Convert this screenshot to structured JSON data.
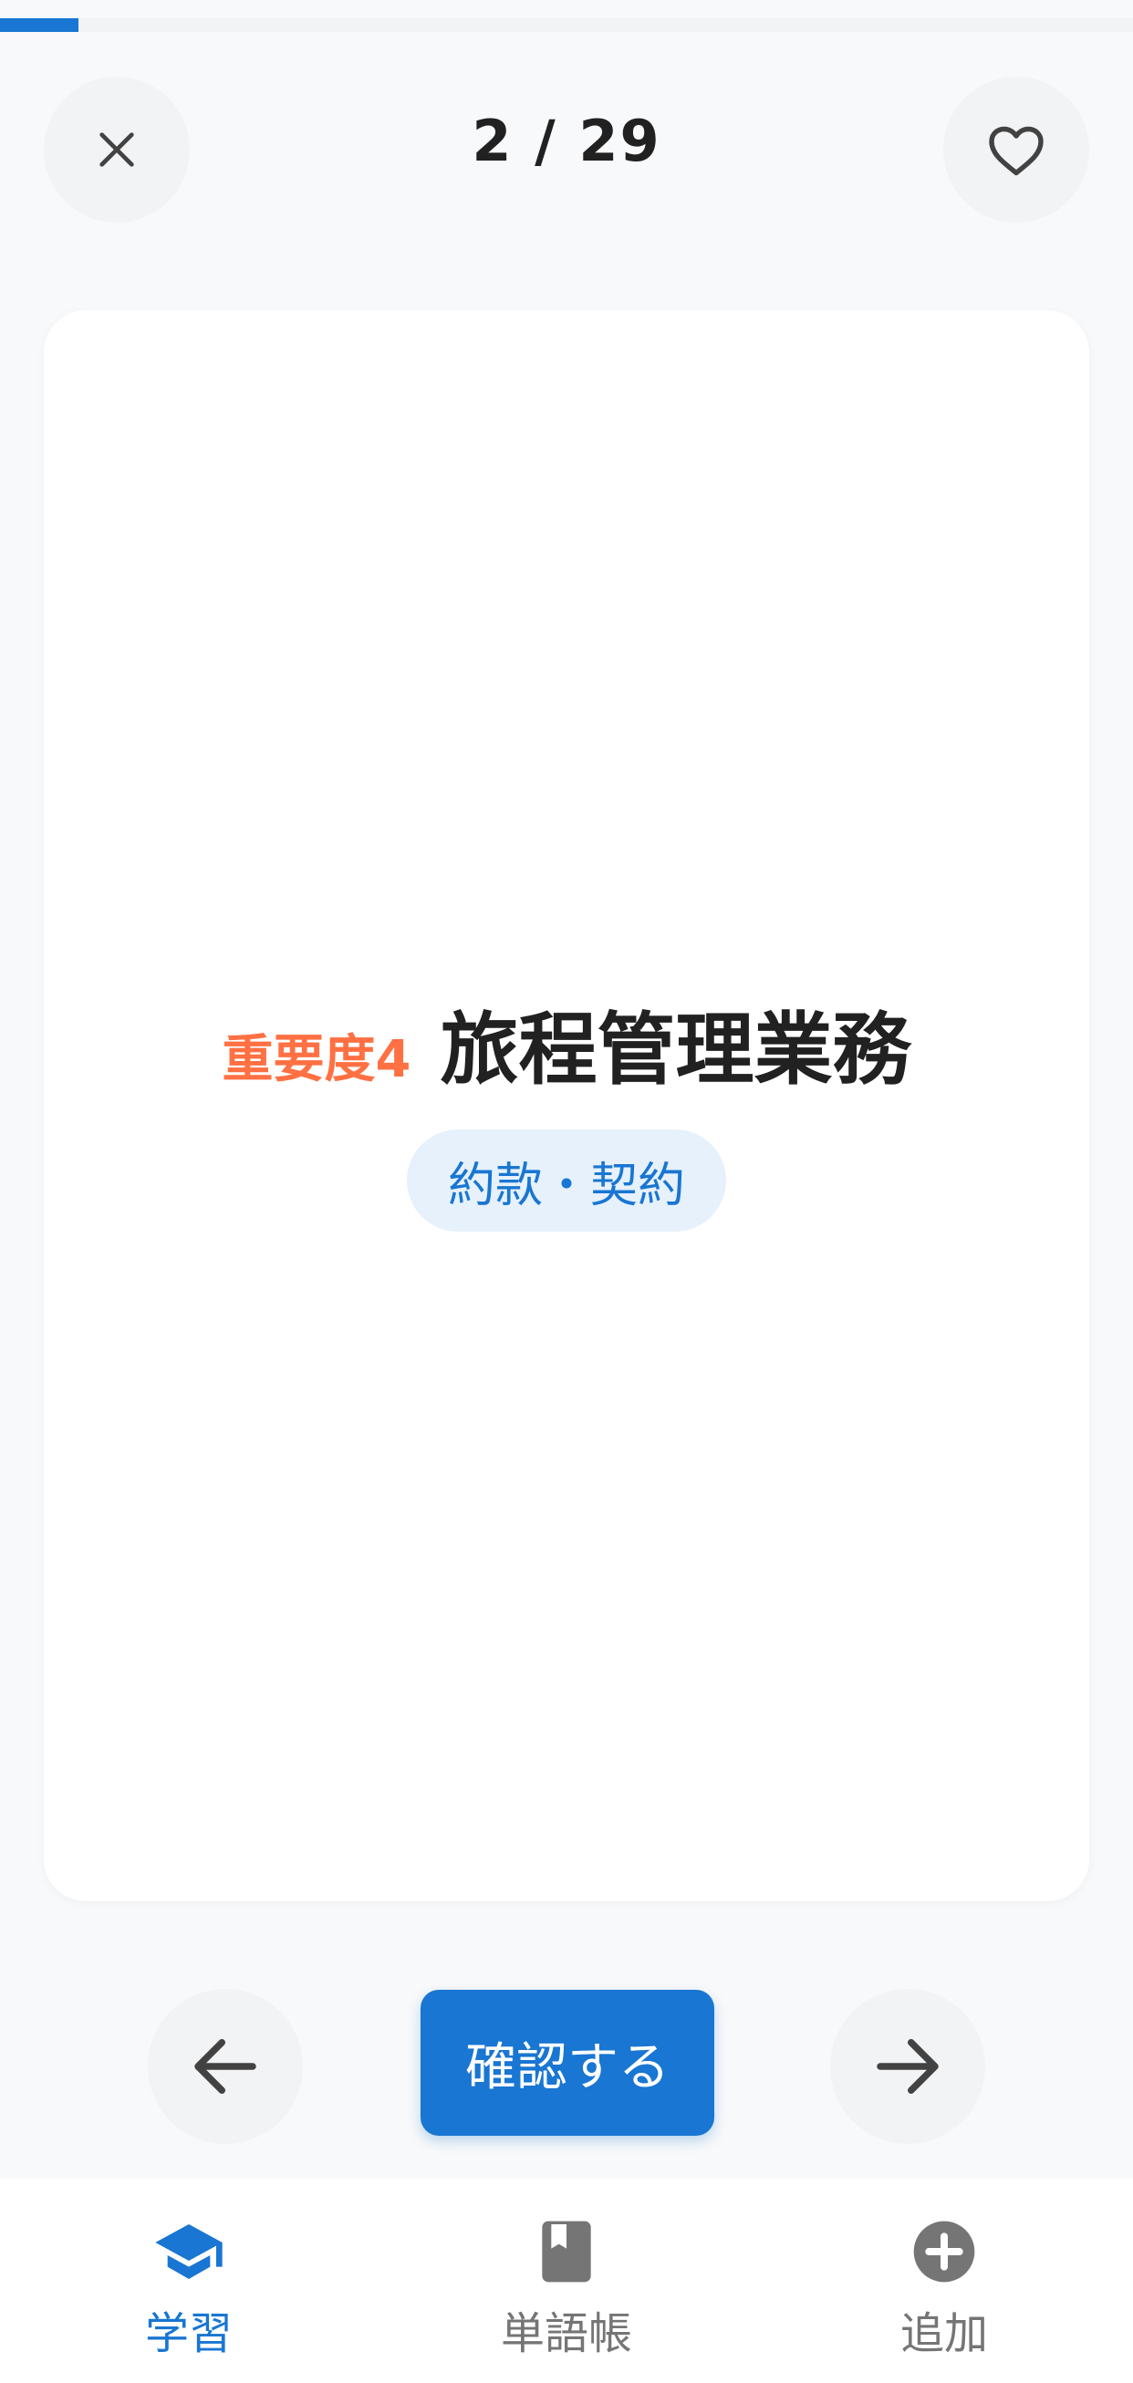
{
  "progress": {
    "current": 2,
    "total": 29,
    "fraction": 0.069
  },
  "header": {
    "counter": "2 / 29"
  },
  "card": {
    "importance": "重要度4",
    "term": "旅程管理業務",
    "category": "約款・契約"
  },
  "controls": {
    "confirm_label": "確認する"
  },
  "bottom_nav": {
    "items": [
      {
        "label": "学習",
        "icon": "graduation-cap-icon",
        "active": true
      },
      {
        "label": "単語帳",
        "icon": "book-icon",
        "active": false
      },
      {
        "label": "追加",
        "icon": "add-circle-icon",
        "active": false
      }
    ]
  },
  "colors": {
    "accent": "#1976d2",
    "importance": "#ff7043",
    "inactive": "#757575",
    "pill_bg": "#e6f1fb"
  }
}
